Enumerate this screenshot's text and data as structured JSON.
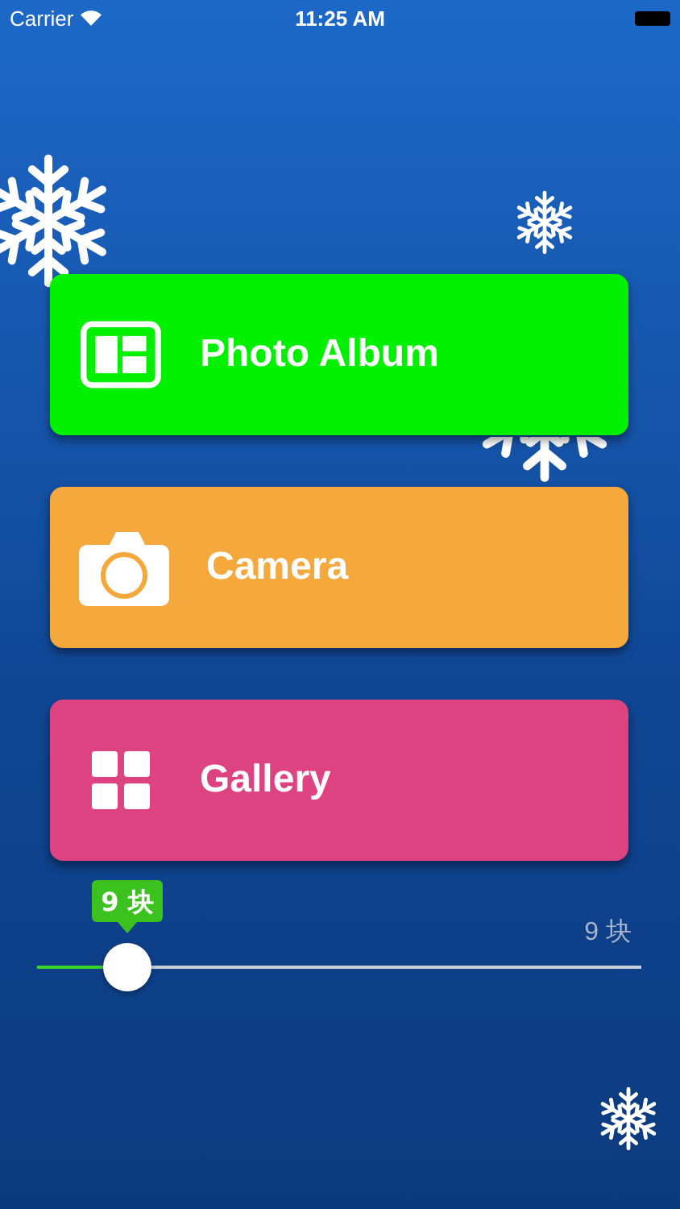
{
  "status_bar": {
    "carrier": "Carrier",
    "time": "11:25 AM"
  },
  "buttons": [
    {
      "label": "Photo Album",
      "kind": "album",
      "color": "#00f000"
    },
    {
      "label": "Camera",
      "kind": "camera",
      "color": "#f5a93c"
    },
    {
      "label": "Gallery",
      "kind": "grid",
      "color": "#dc4380"
    }
  ],
  "slider": {
    "level": 0.15,
    "tooltip": "9 块",
    "reading": "9 块"
  }
}
